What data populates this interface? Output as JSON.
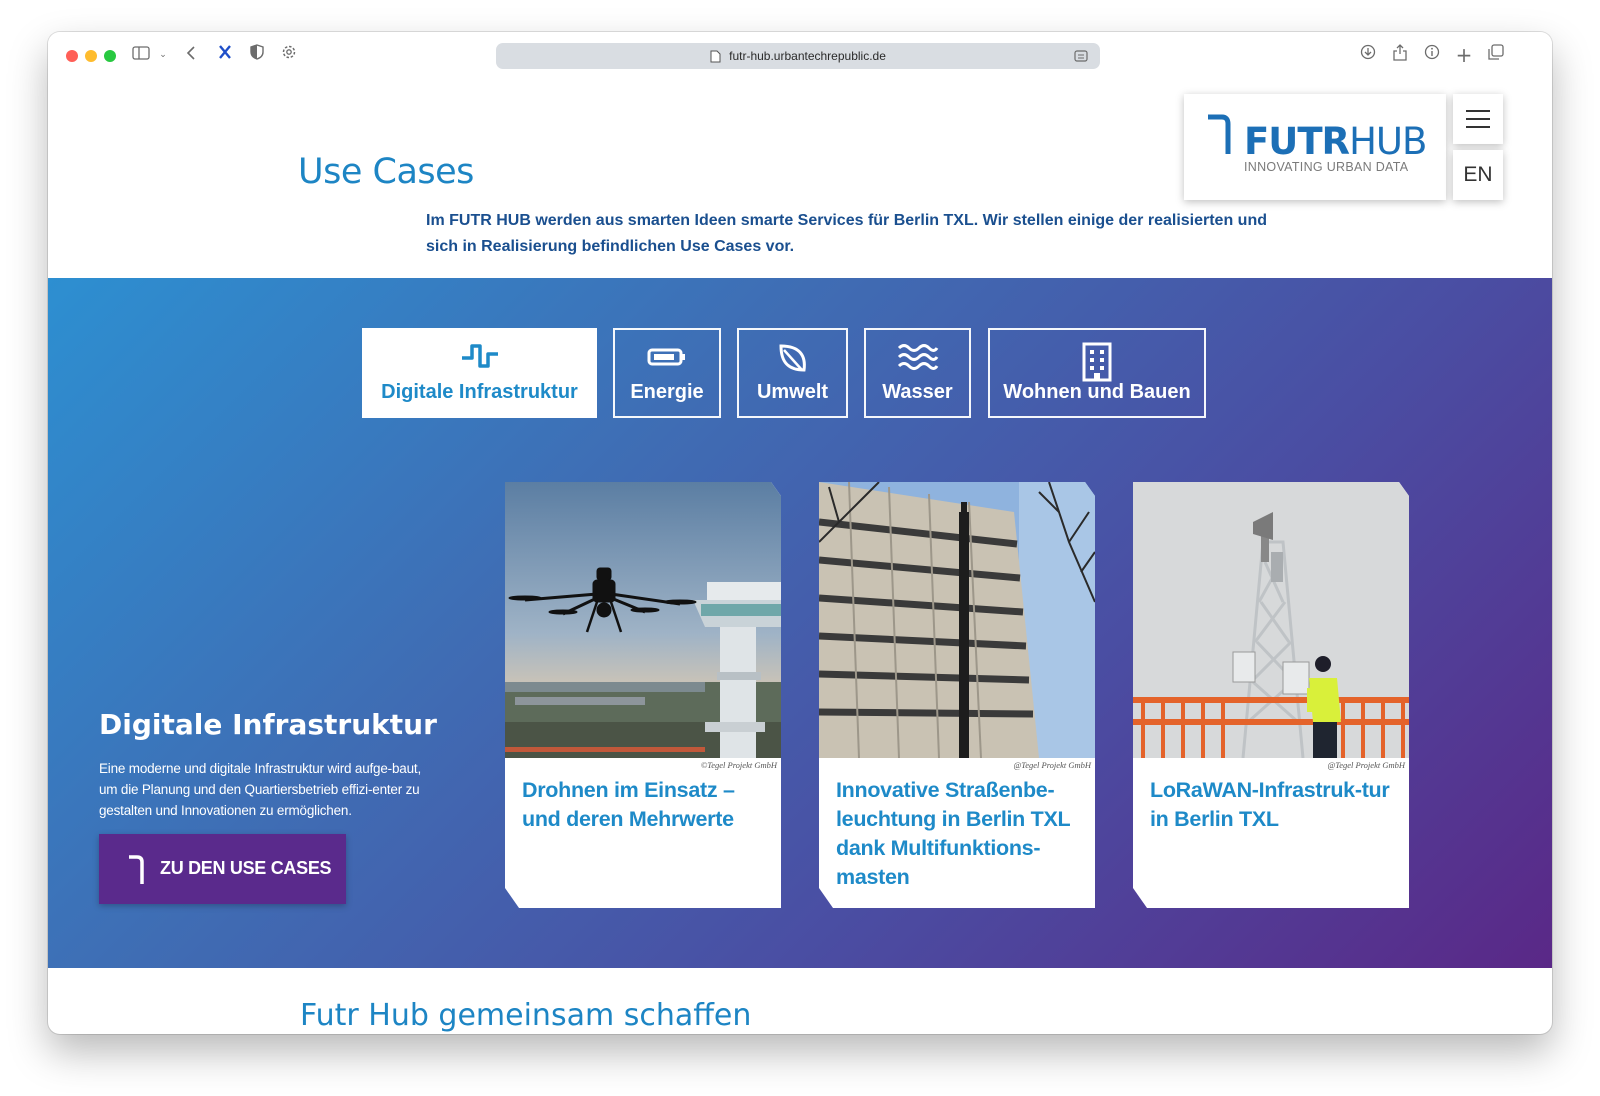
{
  "browser": {
    "url": "futr-hub.urbantechrepublic.de"
  },
  "header": {
    "title": "Use Cases",
    "intro": "Im FUTR HUB werden aus smarten Ideen smarte Services für Berlin TXL. Wir stellen einige der realisierten und sich in Realisierung befindlichen Use Cases vor.",
    "logo_main_bold": "FUTR",
    "logo_main_light": "HUB",
    "logo_sub": "INNOVATING URBAN DATA",
    "lang": "EN"
  },
  "tabs": [
    {
      "label": "Digitale Infrastruktur",
      "icon": "signal-pulse-icon",
      "active": true
    },
    {
      "label": "Energie",
      "icon": "battery-icon",
      "active": false
    },
    {
      "label": "Umwelt",
      "icon": "leaf-icon",
      "active": false
    },
    {
      "label": "Wasser",
      "icon": "water-waves-icon",
      "active": false
    },
    {
      "label": "Wohnen und Bauen",
      "icon": "building-icon",
      "active": false
    }
  ],
  "section": {
    "title": "Digitale Infrastruktur",
    "text": "Eine moderne und digitale Infrastruktur wird aufge-baut, um die Planung und den Quartiersbetrieb effizi-enter zu gestalten und Innovationen zu ermöglichen.",
    "cta_label": "ZU DEN USE CASES"
  },
  "cards": [
    {
      "title": "Drohnen im Einsatz – und deren Mehrwerte",
      "credit": "©Tegel Projekt GmbH"
    },
    {
      "title": "Innovative Straßenbe-leuchtung in Berlin TXL dank Multifunktions-masten",
      "credit": "@Tegel Projekt GmbH"
    },
    {
      "title": "LoRaWAN-Infrastruk-tur in Berlin TXL",
      "credit": "@Tegel Projekt GmbH"
    }
  ],
  "footer_peek": "Futr Hub gemeinsam schaffen",
  "colors": {
    "accent": "#1e8ac8",
    "cta": "#5a2a8c",
    "gradient_start": "#2d8fd1",
    "gradient_end": "#5a2887"
  }
}
